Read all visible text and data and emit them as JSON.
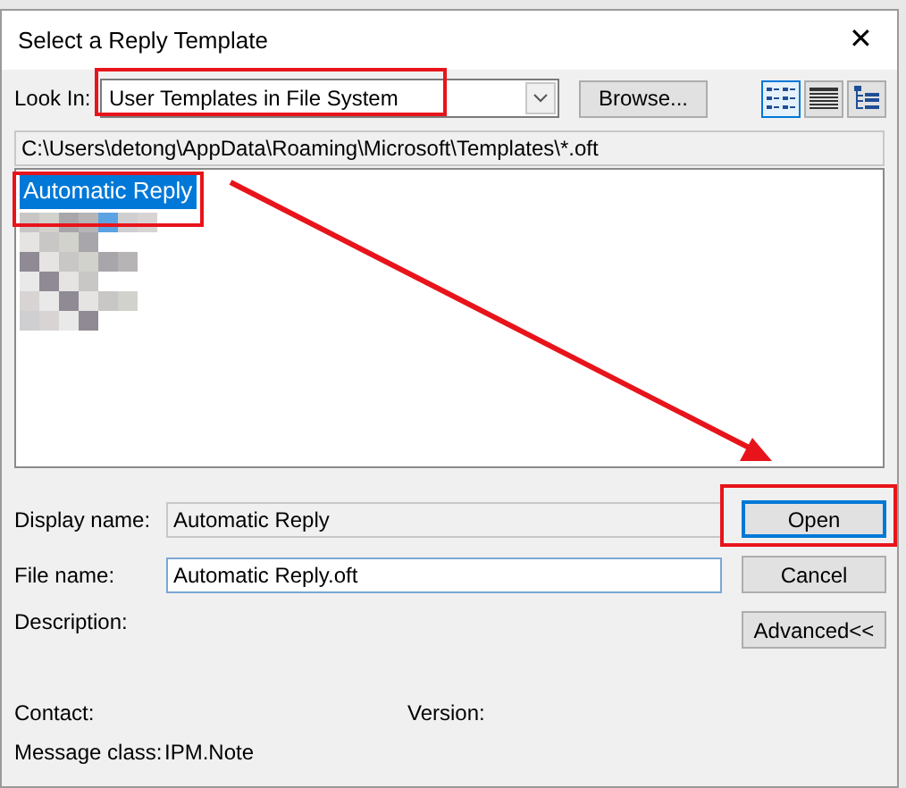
{
  "window": {
    "title": "Select a Reply Template",
    "close": "✕"
  },
  "look_in": {
    "label": "Look In:",
    "value": "User Templates in File System",
    "highlighted": true
  },
  "browse_button": "Browse...",
  "view_buttons": [
    {
      "kind": "list",
      "selected": true
    },
    {
      "kind": "details",
      "selected": false
    },
    {
      "kind": "tree",
      "selected": false
    }
  ],
  "path": "C:\\Users\\detong\\AppData\\Roaming\\Microsoft\\Templates\\*.oft",
  "templates": [
    {
      "name": "Automatic Reply",
      "selected": true,
      "highlighted": true
    },
    {
      "kind": "redacted"
    }
  ],
  "fields": [
    {
      "label": "Display name:",
      "value": "Automatic Reply",
      "editable": false
    },
    {
      "label": "File name:",
      "value": "Automatic Reply.oft",
      "editable": true
    },
    {
      "label": "Description:"
    }
  ],
  "buttons": [
    {
      "label": "Open",
      "default": true,
      "highlighted": true
    },
    {
      "label": "Cancel",
      "default": false,
      "highlighted": false
    },
    {
      "label": "Advanced<<",
      "default": false,
      "highlighted": false
    }
  ],
  "contact": {
    "label": "Contact:"
  },
  "version": {
    "label": "Version:"
  },
  "message_class": {
    "label": "Message class:",
    "value": "IPM.Note"
  },
  "annotations": [
    {
      "kind": "arrow"
    }
  ]
}
